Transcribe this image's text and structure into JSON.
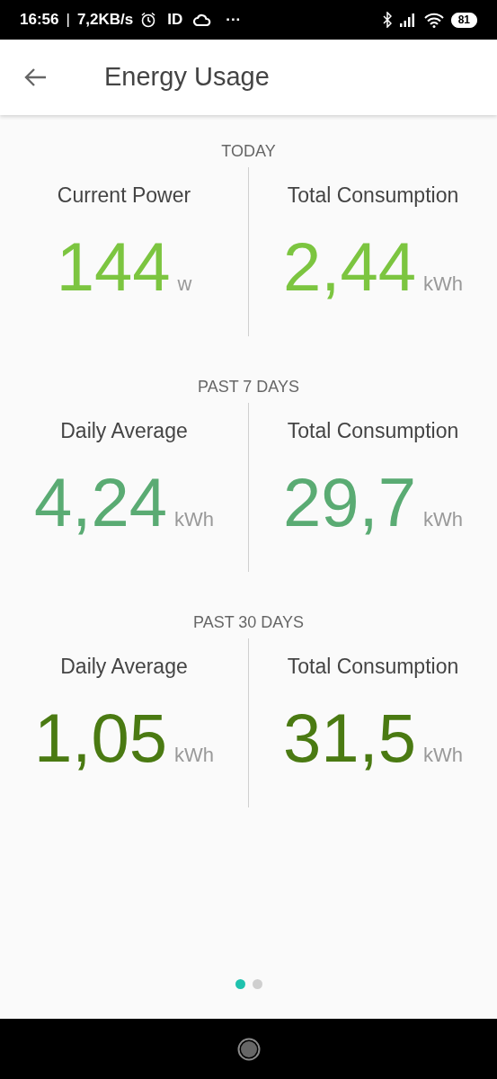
{
  "status_bar": {
    "time": "16:56",
    "separator": "|",
    "speed": "7,2KB/s",
    "carrier": "ID",
    "dots": "···",
    "battery": "81"
  },
  "app_bar": {
    "title": "Energy Usage"
  },
  "sections": [
    {
      "heading": "TODAY",
      "color": "#7cc540",
      "stats": [
        {
          "label": "Current Power",
          "value": "144",
          "unit": "w"
        },
        {
          "label": "Total Consumption",
          "value": "2,44",
          "unit": "kWh"
        }
      ]
    },
    {
      "heading": "PAST 7 DAYS",
      "color": "#5aab73",
      "stats": [
        {
          "label": "Daily Average",
          "value": "4,24",
          "unit": "kWh"
        },
        {
          "label": "Total Consumption",
          "value": "29,7",
          "unit": "kWh"
        }
      ]
    },
    {
      "heading": "PAST 30 DAYS",
      "color": "#4a7a12",
      "stats": [
        {
          "label": "Daily Average",
          "value": "1,05",
          "unit": "kWh"
        },
        {
          "label": "Total Consumption",
          "value": "31,5",
          "unit": "kWh"
        }
      ]
    }
  ],
  "pager": [
    {
      "selected": true
    },
    {
      "selected": false
    }
  ]
}
